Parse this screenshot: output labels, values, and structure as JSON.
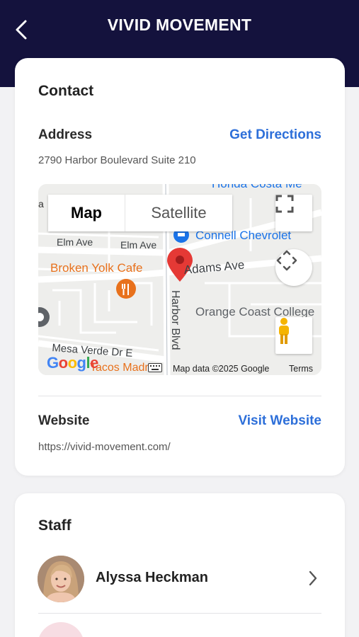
{
  "header": {
    "title": "VIVID MOVEMENT",
    "back_icon": "chevron-left-icon"
  },
  "contact": {
    "section_title": "Contact",
    "address_label": "Address",
    "get_directions": "Get Directions",
    "address_value": "2790 Harbor Boulevard Suite 210",
    "website_label": "Website",
    "visit_website": "Visit Website",
    "website_value": "https://vivid-movement.com/"
  },
  "map": {
    "tab_map": "Map",
    "tab_satellite": "Satellite",
    "labels": {
      "honda": "Honda Costa Me",
      "connell": "Connell Chevrolet",
      "elm_ave_1": "Elm Ave",
      "elm_ave_2": "Elm Ave",
      "adams_ave": "Adams Ave",
      "broken_yolk": "Broken Yolk Cafe",
      "harbor_blvd": "Harbor Blvd",
      "orange_coast": "Orange Coast College",
      "mesa_verde": "Mesa Verde Dr E",
      "tacos": "Tacos Madre",
      "left_a": "a"
    },
    "google_logo": "Google",
    "attribution": "Map data ©2025 Google",
    "terms": "Terms",
    "colors": {
      "marker": "#e53935",
      "poi_orange": "#e8711c",
      "poi_blue": "#1a73e8",
      "water_gray": "#eeeeec"
    }
  },
  "staff": {
    "section_title": "Staff",
    "members": [
      {
        "name": "Alyssa Heckman"
      }
    ],
    "chevron_icon": "chevron-right-icon"
  },
  "colors": {
    "header_bg": "#14123d",
    "link": "#2d6fd9"
  }
}
